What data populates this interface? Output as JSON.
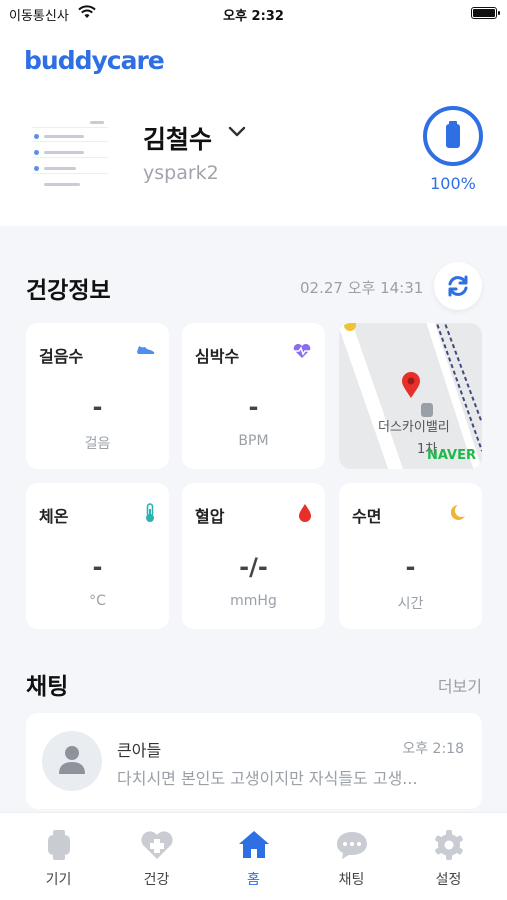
{
  "status_bar": {
    "carrier": "이동통신사",
    "time": "오후 2:32"
  },
  "header": {
    "logo": "buddycare"
  },
  "user": {
    "name": "김철수",
    "id": "yspark2",
    "battery": "100%"
  },
  "health": {
    "title": "건강정보",
    "updated": "02.27 오후 14:31",
    "cards": [
      {
        "title": "걸음수",
        "value": "-",
        "unit": "걸음",
        "icon": "shoe-icon"
      },
      {
        "title": "심박수",
        "value": "-",
        "unit": "BPM",
        "icon": "heartbeat-icon"
      },
      {
        "title": "체온",
        "value": "-",
        "unit": "°C",
        "icon": "thermometer-icon"
      },
      {
        "title": "혈압",
        "value": "-/-",
        "unit": "mmHg",
        "icon": "blood-drop-icon"
      },
      {
        "title": "수면",
        "value": "-",
        "unit": "시간",
        "icon": "moon-icon"
      }
    ],
    "map": {
      "label1": "더스카이밸리",
      "label2": "1차",
      "brand": "NAVER"
    }
  },
  "chat": {
    "title": "채팅",
    "more": "더보기",
    "items": [
      {
        "name": "큰아들",
        "time": "오후 2:18",
        "message": "다치시면 본인도 고생이지만 자식들도 고생..."
      }
    ]
  },
  "tabs": [
    {
      "label": "기기",
      "icon": "watch-icon",
      "active": false
    },
    {
      "label": "건강",
      "icon": "health-heart-icon",
      "active": false
    },
    {
      "label": "홈",
      "icon": "home-icon",
      "active": true
    },
    {
      "label": "채팅",
      "icon": "chat-bubble-icon",
      "active": false
    },
    {
      "label": "설정",
      "icon": "gear-icon",
      "active": false
    }
  ],
  "colors": {
    "accent": "#2f6fe4",
    "inactive": "#c9cdd3",
    "background": "#f4f6f9"
  }
}
